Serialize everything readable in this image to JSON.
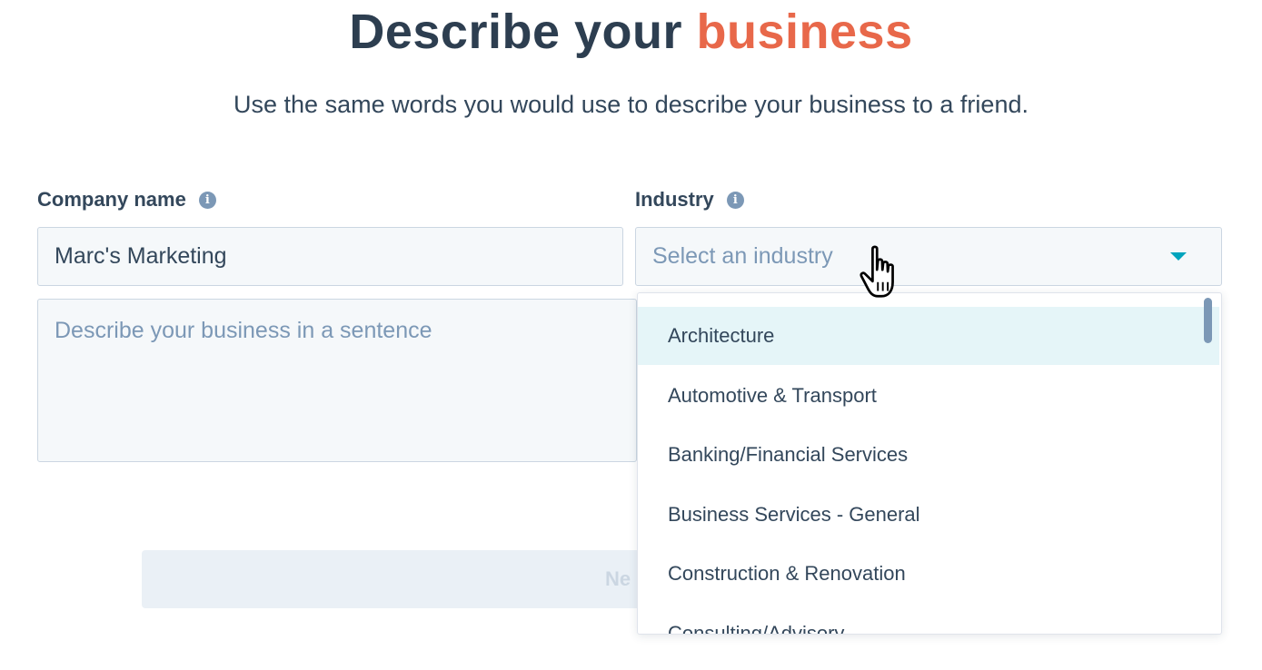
{
  "header": {
    "title_main": "Describe your",
    "title_accent": "business",
    "subtitle": "Use the same words you would use to describe your business to a friend."
  },
  "form": {
    "company_label": "Company name",
    "company_value": "Marc's Marketing",
    "description_placeholder": "Describe your business in a sentence",
    "industry_label": "Industry",
    "industry_placeholder": "Select an industry",
    "next_label": "Ne"
  },
  "dropdown": {
    "options": [
      "Architecture",
      "Automotive & Transport",
      "Banking/Financial Services",
      "Business Services - General",
      "Construction & Renovation",
      "Consulting/Advisory"
    ],
    "highlighted_index": 0
  },
  "icons": {
    "info": "info-icon",
    "caret": "chevron-down-icon",
    "cursor": "hand-pointer-cursor"
  },
  "colors": {
    "accent": "#e8684a",
    "title": "#2d3e50",
    "caret": "#00a4bd",
    "highlight": "#e5f5f8"
  }
}
